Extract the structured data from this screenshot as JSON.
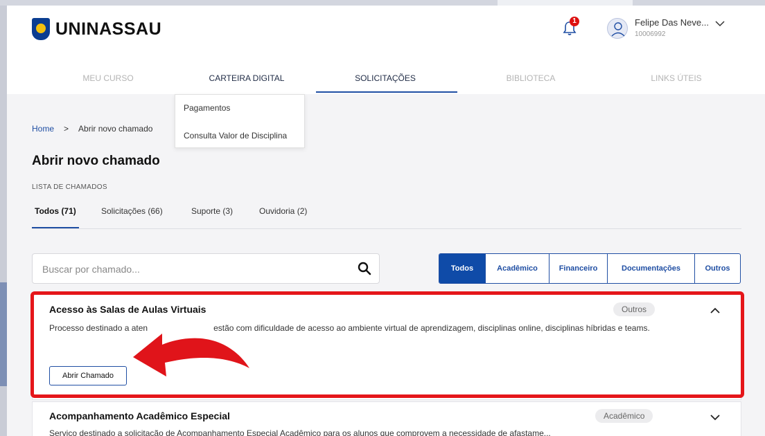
{
  "brand": {
    "name": "UNINASSAU"
  },
  "user": {
    "name": "Felipe Das Neve...",
    "id": "10006992"
  },
  "notifications": {
    "count": "1"
  },
  "nav": {
    "items": [
      {
        "label": "MEU CURSO"
      },
      {
        "label": "CARTEIRA DIGITAL"
      },
      {
        "label": "SOLICITAÇÕES"
      },
      {
        "label": "BIBLIOTECA"
      },
      {
        "label": "LINKS ÚTEIS"
      }
    ]
  },
  "dropdown": {
    "items": [
      {
        "label": "Pagamentos"
      },
      {
        "label": "Consulta Valor de Disciplina"
      }
    ]
  },
  "breadcrumb": {
    "home": "Home",
    "sep": ">",
    "current": "Abrir novo chamado"
  },
  "page": {
    "title": "Abrir novo chamado",
    "list_title": "LISTA DE CHAMADOS"
  },
  "tabs": [
    {
      "label": "Todos (71)"
    },
    {
      "label": "Solicitações (66)"
    },
    {
      "label": "Suporte (3)"
    },
    {
      "label": "Ouvidoria (2)"
    }
  ],
  "search": {
    "placeholder": "Buscar por chamado..."
  },
  "filters": [
    {
      "label": "Todos"
    },
    {
      "label": "Acadêmico"
    },
    {
      "label": "Financeiro"
    },
    {
      "label": "Documentações"
    },
    {
      "label": "Outros"
    }
  ],
  "cards": [
    {
      "title": "Acesso às Salas de Aulas Virtuais",
      "badge": "Outros",
      "desc_start": "Processo destinado a aten",
      "desc_end": "estão com dificuldade de acesso ao ambiente virtual de aprendizagem, disciplinas online, disciplinas híbridas e teams.",
      "button": "Abrir Chamado"
    },
    {
      "title": "Acompanhamento Acadêmico Especial",
      "badge": "Acadêmico",
      "desc": "Serviço destinado a solicitação de Acompanhamento Especial Acadêmico para os alunos que comprovem a necessidade de afastame..."
    }
  ],
  "colors": {
    "accent": "#1f4ea3",
    "highlight": "#e5161a",
    "badge_red": "#dd1111"
  }
}
